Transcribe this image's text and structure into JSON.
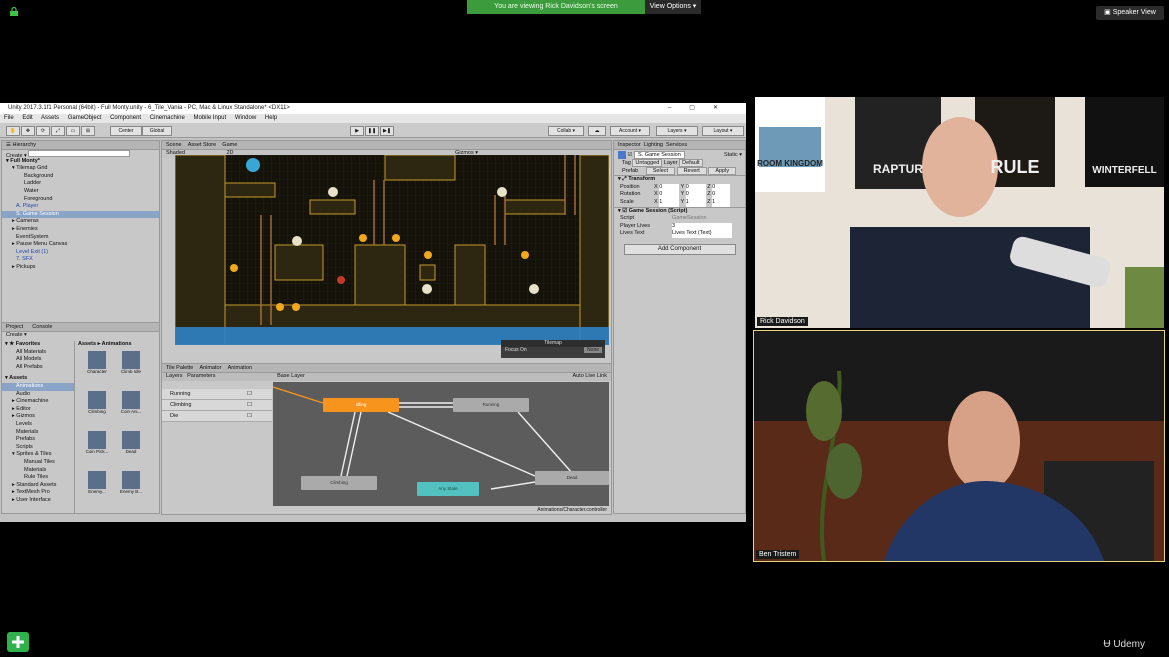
{
  "zoom": {
    "banner_text": "You are viewing Rick Davidson's screen",
    "view_options_label": "View Options",
    "speaker_view_label": "Speaker View"
  },
  "unity": {
    "window_title": "Unity 2017.3.1f1 Personal (64bit) - Full Monty.unity - 6_Tile_Vania - PC, Mac & Linux Standalone* <DX11>",
    "menu": [
      "File",
      "Edit",
      "Assets",
      "GameObject",
      "Component",
      "Cinemachine",
      "Mobile Input",
      "Window",
      "Help"
    ],
    "toolbar": {
      "center": "Center",
      "global": "Global",
      "collab": "Collab ▾",
      "account": "Account ▾",
      "layers": "Layers ▾",
      "layout": "Layout ▾"
    },
    "hierarchy": {
      "title": "Hierarchy",
      "create": "Create ▾",
      "items": [
        "Full Monty*",
        "Tilemap Grid",
        "Background",
        "Ladder",
        "Water",
        "Foreground",
        "A. Player",
        "S. Game Session",
        "Cameras",
        "Enemies",
        "EventSystem",
        "Pause Menu Canvas",
        "Level Exit (1)",
        "7. SFX",
        "Pickups"
      ]
    },
    "project": {
      "tabs": [
        "Project",
        "Console"
      ],
      "create": "Create ▾",
      "favorites_title": "Favorites",
      "favorites": [
        "All Materials",
        "All Models",
        "All Prefabs"
      ],
      "assets_title": "Assets",
      "folders": [
        "Animations",
        "Audio",
        "Cinemachine",
        "Editor",
        "Gizmos",
        "Levels",
        "Materials",
        "Prefabs",
        "Scripts",
        "Sprites & Tiles",
        "Manual Tiles",
        "Materials",
        "Rule Tiles",
        "Standard Assets",
        "TextMesh Pro",
        "User Interface"
      ],
      "breadcrumb": "Assets ▸ Animations",
      "grid_items": [
        "Character",
        "Climb Idle",
        "Climbing",
        "Coin Ani...",
        "Coin Pick...",
        "Dead",
        "Enemy...",
        "Enemy B..."
      ]
    },
    "scene": {
      "tabs": [
        "Scene",
        "Asset Store",
        "Game"
      ],
      "shaded": "Shaded",
      "mode_2d": "2D",
      "gizmos": "Gizmos ▾",
      "tilemap_overlay_title": "Tilemap",
      "focus_on_label": "Focus On",
      "focus_on_value": "None"
    },
    "animator": {
      "tabs": [
        "Tile Palette",
        "Animator",
        "Animation"
      ],
      "sub_tabs": [
        "Layers",
        "Parameters"
      ],
      "base_layer": "Base Layer",
      "auto_live_link": "Auto Live Link",
      "parameters": [
        "Running",
        "Climbing",
        "Die"
      ],
      "states": {
        "idling": "Idling",
        "running": "Running",
        "climbing": "Climbing",
        "any_state": "Any State",
        "dead": "Dead"
      },
      "footer_path": "Animations/Character.controller"
    },
    "inspector": {
      "tabs": [
        "Inspector",
        "Lighting",
        "Services"
      ],
      "object_name": "S. Game Session",
      "static_label": "Static ▾",
      "tag_label": "Tag",
      "tag_value": "Untagged",
      "layer_label": "Layer",
      "layer_value": "Default",
      "prefab_label": "Prefab",
      "prefab_buttons": [
        "Select",
        "Revert",
        "Apply"
      ],
      "transform_title": "Transform",
      "transform_rows": [
        {
          "label": "Position",
          "x": "0",
          "y": "0",
          "z": "0"
        },
        {
          "label": "Rotation",
          "x": "0",
          "y": "0",
          "z": "0"
        },
        {
          "label": "Scale",
          "x": "1",
          "y": "1",
          "z": "1"
        }
      ],
      "script_component_title": "Game Session (Script)",
      "script_label": "Script",
      "script_value": "GameSession",
      "player_lives_label": "Player Lives",
      "player_lives_value": "3",
      "lives_text_label": "Lives Text",
      "lives_text_value": "Lives Text (Text)",
      "add_component": "Add Component"
    }
  },
  "participants": [
    {
      "name": "Rick Davidson"
    },
    {
      "name": "Ben Tristem"
    }
  ],
  "posters": [
    "ROOM KINGDOM",
    "RAPTUR",
    "RULE",
    "WINTERFELL"
  ],
  "udemy": "Udemy",
  "colors": {
    "zoom_banner": "#3c9b3c",
    "active_speaker_border": "#e8d77a",
    "animator_idle_state": "#f7941d",
    "animator_any_state": "#54c1c1"
  }
}
